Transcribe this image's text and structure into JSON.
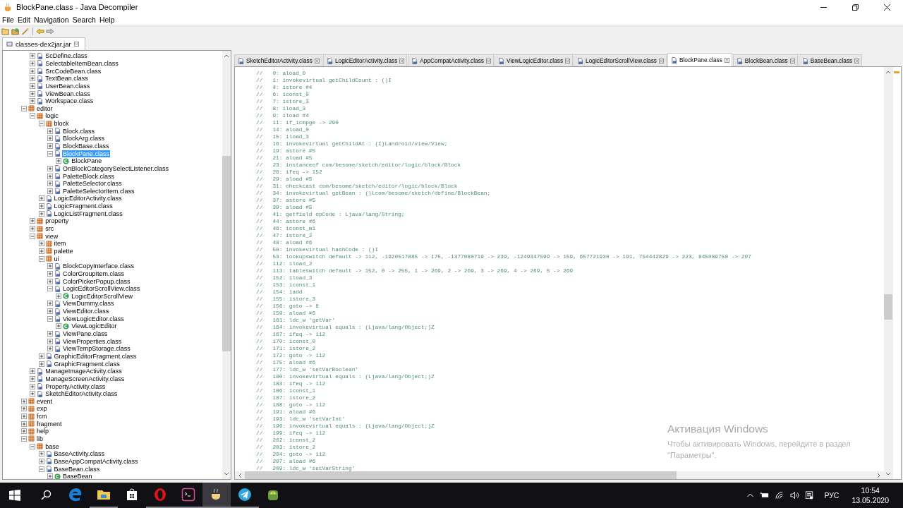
{
  "window": {
    "title": "BlockPane.class - Java Decompiler"
  },
  "menu": [
    "File",
    "Edit",
    "Navigation",
    "Search",
    "Help"
  ],
  "left_panel": {
    "tab": "classes-dex2jar.jar",
    "continued_items": [
      {
        "label": "ScDefine.class",
        "kind": "class_file",
        "expanded": false,
        "selected": false
      },
      {
        "label": "SelectableItemBean.class",
        "kind": "class_file",
        "expanded": false,
        "selected": false
      },
      {
        "label": "SrcCodeBean.class",
        "kind": "class_file",
        "expanded": false,
        "selected": false
      },
      {
        "label": "TextBean.class",
        "kind": "class_file",
        "expanded": false,
        "selected": false
      },
      {
        "label": "UserBean.class",
        "kind": "class_file",
        "expanded": false,
        "selected": false
      },
      {
        "label": "ViewBean.class",
        "kind": "class_file",
        "expanded": false,
        "selected": false
      },
      {
        "label": "Workspace.class",
        "kind": "class_file",
        "expanded": false,
        "selected": false
      }
    ],
    "items": [
      {
        "label": "editor",
        "kind": "package",
        "expanded": true,
        "selected": false,
        "children": [
          {
            "label": "logic",
            "kind": "package",
            "expanded": true,
            "selected": false,
            "children": [
              {
                "label": "block",
                "kind": "package",
                "expanded": true,
                "selected": false,
                "children": [
                  {
                    "label": "Block.class",
                    "kind": "class_file",
                    "expanded": false,
                    "selected": false
                  },
                  {
                    "label": "BlockArg.class",
                    "kind": "class_file",
                    "expanded": false,
                    "selected": false
                  },
                  {
                    "label": "BlockBase.class",
                    "kind": "class_file",
                    "expanded": false,
                    "selected": false
                  },
                  {
                    "label": "BlockPane.class",
                    "kind": "class_file",
                    "expanded": true,
                    "selected": true,
                    "children": [
                      {
                        "label": "BlockPane",
                        "kind": "class",
                        "expanded": false,
                        "selected": false
                      }
                    ]
                  },
                  {
                    "label": "OnBlockCategorySelectListener.class",
                    "kind": "class_file",
                    "expanded": false,
                    "selected": false
                  },
                  {
                    "label": "PaletteBlock.class",
                    "kind": "class_file",
                    "expanded": false,
                    "selected": false
                  },
                  {
                    "label": "PaletteSelector.class",
                    "kind": "class_file",
                    "expanded": false,
                    "selected": false
                  },
                  {
                    "label": "PaletteSelectorItem.class",
                    "kind": "class_file",
                    "expanded": false,
                    "selected": false
                  }
                ]
              },
              {
                "label": "LogicEditorActivity.class",
                "kind": "class_file",
                "expanded": false,
                "selected": false
              },
              {
                "label": "LogicFragment.class",
                "kind": "class_file",
                "expanded": false,
                "selected": false
              },
              {
                "label": "LogicListFragment.class",
                "kind": "class_file",
                "expanded": false,
                "selected": false
              }
            ]
          },
          {
            "label": "property",
            "kind": "package",
            "expanded": false,
            "selected": false
          },
          {
            "label": "src",
            "kind": "package",
            "expanded": false,
            "selected": false
          },
          {
            "label": "view",
            "kind": "package",
            "expanded": true,
            "selected": false,
            "children": [
              {
                "label": "item",
                "kind": "package",
                "expanded": false,
                "selected": false
              },
              {
                "label": "palette",
                "kind": "package",
                "expanded": false,
                "selected": false
              },
              {
                "label": "ui",
                "kind": "package",
                "expanded": true,
                "selected": false,
                "children": [
                  {
                    "label": "BlockCopyInterface.class",
                    "kind": "class_file",
                    "expanded": false,
                    "selected": false
                  },
                  {
                    "label": "ColorGroupItem.class",
                    "kind": "class_file",
                    "expanded": false,
                    "selected": false
                  },
                  {
                    "label": "ColorPickerPopup.class",
                    "kind": "class_file",
                    "expanded": false,
                    "selected": false
                  },
                  {
                    "label": "LogicEditorScrollView.class",
                    "kind": "class_file",
                    "expanded": true,
                    "selected": false,
                    "children": [
                      {
                        "label": "LogicEditorScrollView",
                        "kind": "class",
                        "expanded": false,
                        "selected": false
                      }
                    ]
                  },
                  {
                    "label": "ViewDummy.class",
                    "kind": "class_file",
                    "expanded": false,
                    "selected": false
                  },
                  {
                    "label": "ViewEditor.class",
                    "kind": "class_file",
                    "expanded": false,
                    "selected": false
                  },
                  {
                    "label": "ViewLogicEditor.class",
                    "kind": "class_file",
                    "expanded": true,
                    "selected": false,
                    "children": [
                      {
                        "label": "ViewLogicEditor",
                        "kind": "class",
                        "expanded": false,
                        "selected": false
                      }
                    ]
                  },
                  {
                    "label": "ViewPane.class",
                    "kind": "class_file",
                    "expanded": false,
                    "selected": false
                  },
                  {
                    "label": "ViewProperties.class",
                    "kind": "class_file",
                    "expanded": false,
                    "selected": false
                  },
                  {
                    "label": "ViewTempStorage.class",
                    "kind": "class_file",
                    "expanded": false,
                    "selected": false
                  }
                ]
              },
              {
                "label": "GraphicEditorFragment.class",
                "kind": "class_file",
                "expanded": false,
                "selected": false
              },
              {
                "label": "GraphicFragment.class",
                "kind": "class_file",
                "expanded": false,
                "selected": false
              }
            ]
          },
          {
            "label": "ManageImageActivity.class",
            "kind": "class_file",
            "expanded": false,
            "selected": false
          },
          {
            "label": "ManageScreenActivity.class",
            "kind": "class_file",
            "expanded": false,
            "selected": false
          },
          {
            "label": "PropertyActivity.class",
            "kind": "class_file",
            "expanded": false,
            "selected": false
          },
          {
            "label": "SketchEditorActivity.class",
            "kind": "class_file",
            "expanded": false,
            "selected": false
          }
        ]
      },
      {
        "label": "event",
        "kind": "package",
        "expanded": false,
        "selected": false
      },
      {
        "label": "exp",
        "kind": "package",
        "expanded": false,
        "selected": false
      },
      {
        "label": "fcm",
        "kind": "package",
        "expanded": false,
        "selected": false
      },
      {
        "label": "fragment",
        "kind": "package",
        "expanded": false,
        "selected": false
      },
      {
        "label": "help",
        "kind": "package",
        "expanded": false,
        "selected": false
      },
      {
        "label": "lib",
        "kind": "package",
        "expanded": true,
        "selected": false,
        "children": [
          {
            "label": "base",
            "kind": "package",
            "expanded": true,
            "selected": false,
            "children": [
              {
                "label": "BaseActivity.class",
                "kind": "class_file",
                "expanded": false,
                "selected": false
              },
              {
                "label": "BaseAppCompatActivity.class",
                "kind": "class_file",
                "expanded": false,
                "selected": false
              },
              {
                "label": "BaseBean.class",
                "kind": "class_file",
                "expanded": true,
                "selected": false,
                "children": [
                  {
                    "label": "BaseBean",
                    "kind": "class",
                    "expanded": false,
                    "selected": false
                  }
                ]
              }
            ]
          }
        ]
      }
    ]
  },
  "editor_tabs": [
    {
      "label": "SketchEditorActivity.class",
      "selected": false
    },
    {
      "label": "LogicEditorActivity.class",
      "selected": false
    },
    {
      "label": "AppCompatActivity.class",
      "selected": false
    },
    {
      "label": "ViewLogicEditor.class",
      "selected": false
    },
    {
      "label": "LogicEditorScrollView.class",
      "selected": false
    },
    {
      "label": "BlockPane.class",
      "selected": true
    },
    {
      "label": "BlockBean.class",
      "selected": false
    },
    {
      "label": "BaseBean.class",
      "selected": false
    }
  ],
  "code_lines": [
    "//   0: aload_0",
    "//   1: invokevirtual getChildCount : ()I",
    "//   4: istore #4",
    "//   6: iconst_0",
    "//   7: istore_3",
    "//   8: iload_3",
    "//   9: iload #4",
    "//   11: if_icmpge -> 290",
    "//   14: aload_0",
    "//   15: iload_3",
    "//   16: invokevirtual getChildAt : (I)Landroid/view/View;",
    "//   19: astore #5",
    "//   21: aload #5",
    "//   23: instanceof com/besome/sketch/editor/logic/block/Block",
    "//   26: ifeq -> 152",
    "//   29: aload #5",
    "//   31: checkcast com/besome/sketch/editor/logic/block/Block",
    "//   34: invokevirtual getBean : ()Lcom/besome/sketch/define/BlockBean;",
    "//   37: astore #5",
    "//   39: aload #5",
    "//   41: getfield opCode : Ljava/lang/String;",
    "//   44: astore #6",
    "//   46: iconst_m1",
    "//   47: istore_2",
    "//   48: aload #6",
    "//   50: invokevirtual hashCode : ()I",
    "//   53: lookupswitch default -> 112, -1920517885 -> 175, -1377080719 -> 239, -1249347599 -> 159, 657721930 -> 191, 754442829 -> 223, 845089750 -> 207",
    "//   112: iload_2",
    "//   113: tableswitch default -> 152, 0 -> 255, 1 -> 269, 2 -> 269, 3 -> 269, 4 -> 269, 5 -> 269",
    "//   152: iload_3",
    "//   153: iconst_1",
    "//   154: iadd",
    "//   155: istore_3",
    "//   156: goto -> 8",
    "//   159: aload #6",
    "//   161: ldc_w 'getVar'",
    "//   164: invokevirtual equals : (Ljava/lang/Object;)Z",
    "//   167: ifeq -> 112",
    "//   170: iconst_0",
    "//   171: istore_2",
    "//   172: goto -> 112",
    "//   175: aload #6",
    "//   177: ldc_w 'setVarBoolean'",
    "//   180: invokevirtual equals : (Ljava/lang/Object;)Z",
    "//   183: ifeq -> 112",
    "//   186: iconst_1",
    "//   187: istore_2",
    "//   188: goto -> 112",
    "//   191: aload #6",
    "//   193: ldc_w 'setVarInt'",
    "//   196: invokevirtual equals : (Ljava/lang/Object;)Z",
    "//   199: ifeq -> 112",
    "//   202: iconst_2",
    "//   203: istore_2",
    "//   204: goto -> 112",
    "//   207: aload #6",
    "//   209: ldc_w 'setVarString'"
  ],
  "activation_notice": {
    "title": "Активация Windows",
    "text": "Чтобы активировать Windows, перейдите в раздел \"Параметры\"."
  },
  "taskbar": {
    "apps": [
      {
        "running": false,
        "selected": false
      },
      {
        "running": true,
        "selected": false
      },
      {
        "running": false,
        "selected": false
      },
      {
        "running": true,
        "selected": false
      },
      {
        "running": true,
        "selected": false
      },
      {
        "running": true,
        "selected": true
      },
      {
        "running": true,
        "selected": false
      },
      {
        "running": false,
        "selected": false
      }
    ],
    "language": "РУС",
    "time": "10:54",
    "date": "13.05.2020"
  }
}
